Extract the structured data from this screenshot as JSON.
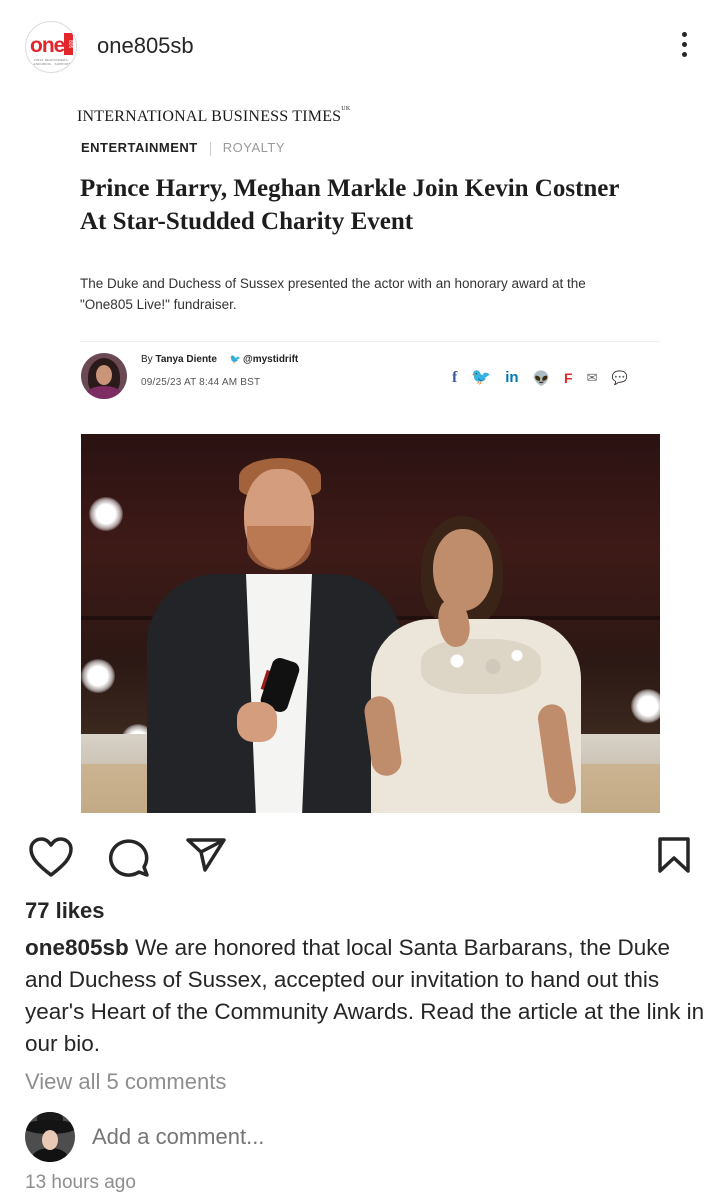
{
  "post": {
    "username": "one805sb",
    "avatar_logo": "one",
    "avatar_logo_badge": "805",
    "avatar_tagline": "FIRST RESPONDERS · ENDURING · SUPPORT",
    "more_icon": "more-vertical-icon"
  },
  "article": {
    "publication": "INTERNATIONAL BUSINESS TIMES",
    "publication_suffix": "UK",
    "category": "ENTERTAINMENT",
    "subcategory": "ROYALTY",
    "headline": "Prince Harry, Meghan Markle Join Kevin Costner At Star-Studded Charity Event",
    "summary": "The Duke and Duchess of Sussex presented the actor with an honorary award at the \"One805 Live!\" fundraiser.",
    "byline_prefix": "By",
    "author": "Tanya Diente",
    "twitter_handle": "@mystidrift",
    "date": "09/25/23 AT 8:44 AM BST",
    "share_icons": {
      "facebook": "f",
      "twitter": "🐦",
      "linkedin": "in",
      "reddit": "👽",
      "flipboard": "F",
      "email": "✉",
      "comment": "💬"
    }
  },
  "actions": {
    "like_icon": "heart-icon",
    "comment_icon": "comment-icon",
    "share_icon": "send-icon",
    "save_icon": "bookmark-icon"
  },
  "likes": "77 likes",
  "caption": {
    "username": "one805sb",
    "text": "We are honored that local Santa Barbarans, the Duke and Duchess of Sussex, accepted our invitation to hand out this year's Heart of the Community Awards. Read the article at the link in our bio."
  },
  "view_comments": "View all 5 comments",
  "add_comment_placeholder": "Add a comment...",
  "timestamp": "13 hours ago"
}
